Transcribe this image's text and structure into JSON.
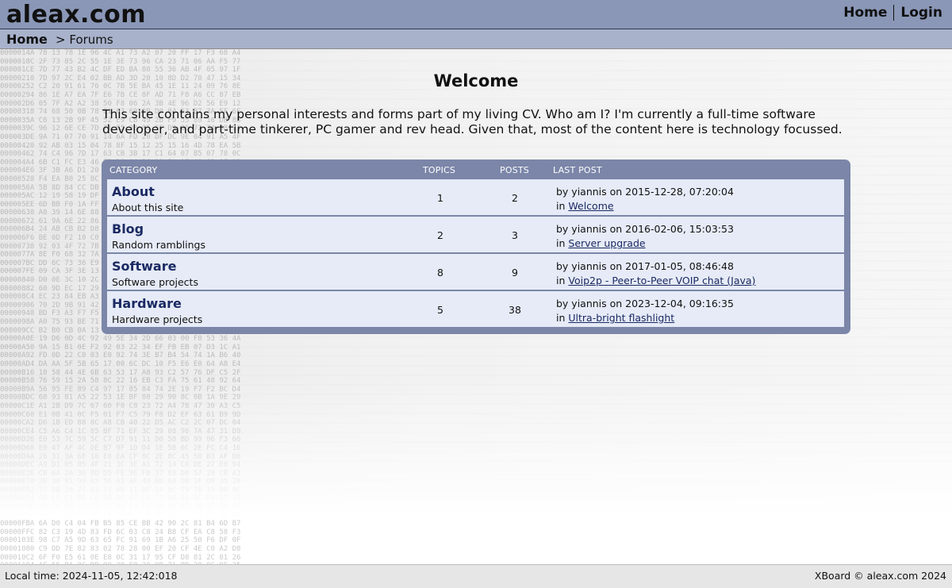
{
  "site": {
    "title": "aleax.com"
  },
  "top_nav": {
    "home": "Home",
    "login": "Login"
  },
  "breadcrumb": {
    "home": "Home",
    "separator": ">",
    "current": "Forums"
  },
  "welcome": {
    "title": "Welcome",
    "intro": "This site contains my personal interests and forms part of my living CV. Who am I? I'm currently a full-time software developer, and part-time tinkerer, PC gamer and rev head. Given that, most of the content here is technology focussed."
  },
  "forum_table": {
    "headers": {
      "category": "CATEGORY",
      "topics": "TOPICS",
      "posts": "POSTS",
      "last_post": "LAST POST"
    },
    "rows": [
      {
        "name": "About",
        "description": "About this site",
        "topics": "1",
        "posts": "2",
        "last_post_by": "by yiannis on 2015-12-28, 07:20:04",
        "in_label": "in",
        "last_post_link": "Welcome"
      },
      {
        "name": "Blog",
        "description": "Random ramblings",
        "topics": "2",
        "posts": "3",
        "last_post_by": "by yiannis on 2016-02-06, 15:03:53",
        "in_label": "in",
        "last_post_link": "Server upgrade"
      },
      {
        "name": "Software",
        "description": "Software projects",
        "topics": "8",
        "posts": "9",
        "last_post_by": "by yiannis on 2017-01-05, 08:46:48",
        "in_label": "in",
        "last_post_link": "Voip2p - Peer-to-Peer VOIP chat (Java)"
      },
      {
        "name": "Hardware",
        "description": "Hardware projects",
        "topics": "5",
        "posts": "38",
        "last_post_by": "by yiannis on 2023-12-04, 09:16:35",
        "in_label": "in",
        "last_post_link": "Ultra-bright flashlight"
      }
    ]
  },
  "footer": {
    "local_time": "Local time: 2024-11-05, 12:42:018",
    "copyright": "XBoard © aleax.com 2024"
  },
  "colors": {
    "header": "#8a97b7",
    "breadcrumb": "#a8b2cb",
    "table": "#7b86a8",
    "row": "#e6ebf7",
    "link": "#1b2a63"
  }
}
